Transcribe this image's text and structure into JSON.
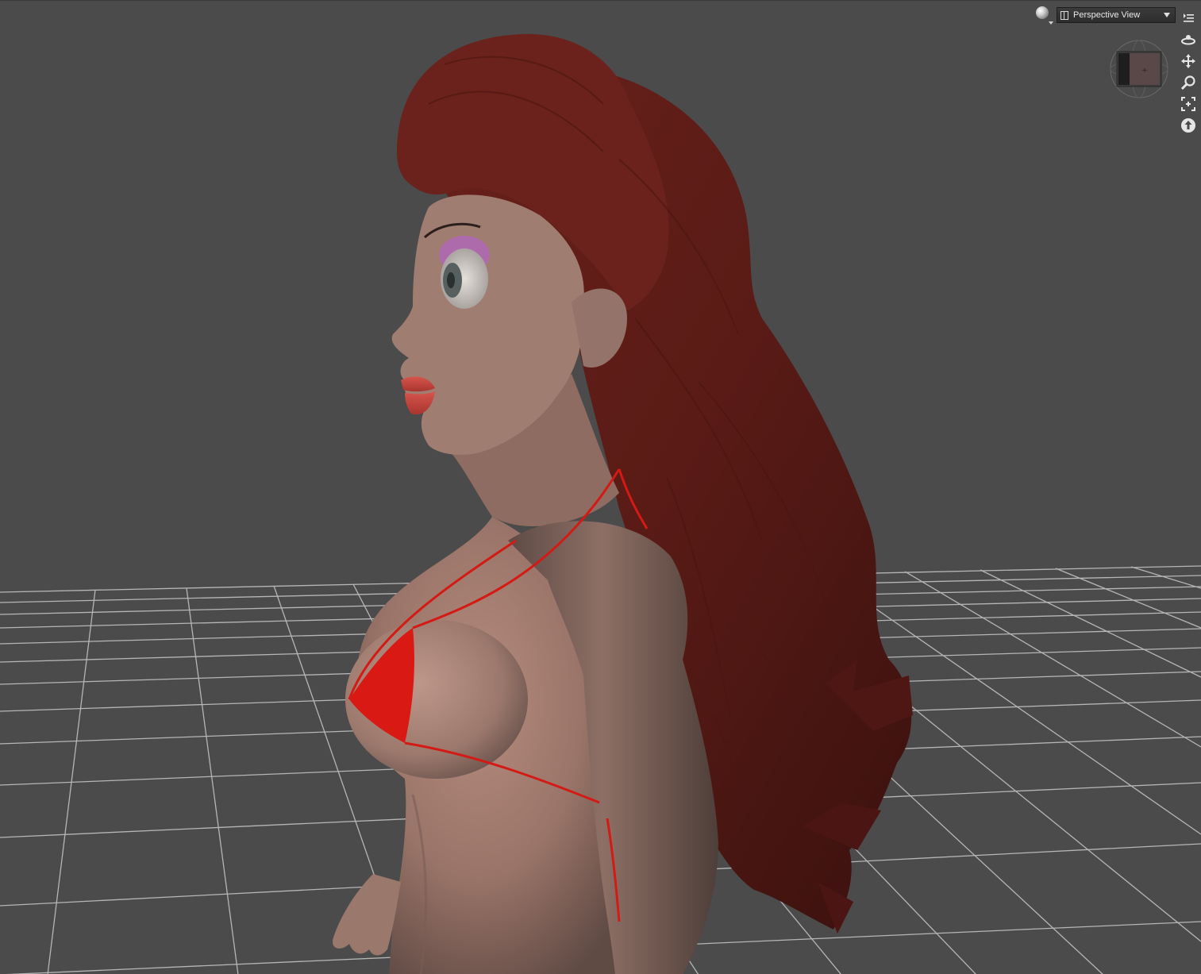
{
  "viewport": {
    "camera_label": "Perspective View",
    "background_color": "#4b4b4b",
    "grid_color": "#c8c8c8"
  },
  "toolbar": {
    "render_mode_icon": "draw-style-sphere-icon",
    "camera_icon": "camera-view-icon",
    "dropdown_icon": "chevron-down-icon",
    "menu_icon": "viewport-menu-icon"
  },
  "nav_tools": [
    {
      "name": "orbit-icon"
    },
    {
      "name": "pan-icon"
    },
    {
      "name": "zoom-icon"
    },
    {
      "name": "frame-icon"
    },
    {
      "name": "reset-view-icon"
    }
  ],
  "figure": {
    "hair_color": "#5e1b17",
    "skin_color": "#a88274",
    "bikini_color": "#d91a14",
    "lip_color": "#c8453d"
  }
}
